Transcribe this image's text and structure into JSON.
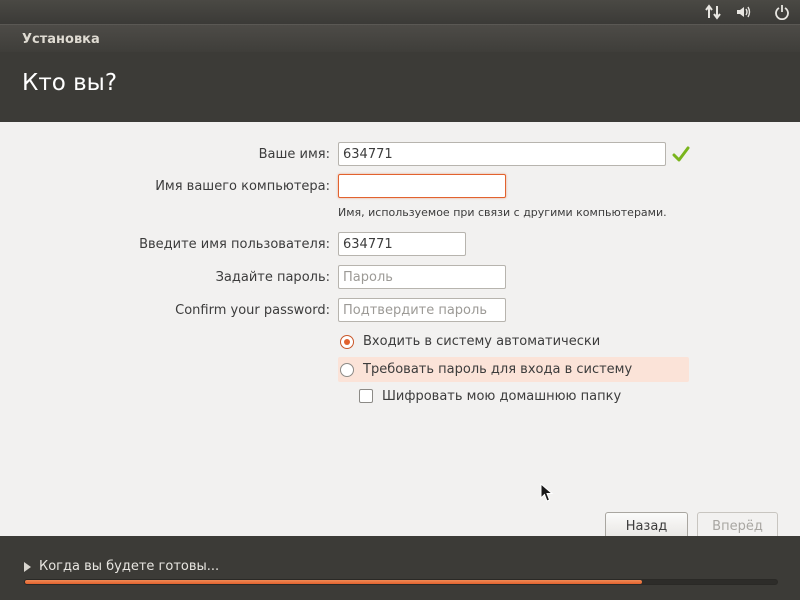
{
  "tray": {
    "icons": [
      "network-arrows-icon",
      "volume-icon",
      "power-icon"
    ]
  },
  "window": {
    "title": "Установка"
  },
  "header": {
    "title": "Кто вы?"
  },
  "form": {
    "name": {
      "label": "Ваше имя:",
      "value": "634771",
      "valid": true
    },
    "computer": {
      "label": "Имя вашего компьютера:",
      "value": "",
      "hint": "Имя, используемое при связи с другими компьютерами."
    },
    "username": {
      "label": "Введите имя пользователя:",
      "value": "634771"
    },
    "password": {
      "label": "Задайте пароль:",
      "placeholder": "Пароль"
    },
    "confirm": {
      "label": "Confirm your password:",
      "placeholder": "Подтвердите пароль"
    },
    "login_options": [
      {
        "label": "Входить в систему автоматически",
        "selected": true
      },
      {
        "label": "Требовать пароль для входа в систему",
        "selected": false
      }
    ],
    "encrypt": {
      "label": "Шифровать мою домашнюю папку",
      "checked": false
    }
  },
  "buttons": {
    "back": "Назад",
    "forward": "Вперёд"
  },
  "status": {
    "ready_label": "Когда вы будете готовы...",
    "progress": 0.82
  },
  "colors": {
    "accent": "#e2622e",
    "panel": "#3c3b37",
    "valid_check": "#7ab51d"
  }
}
